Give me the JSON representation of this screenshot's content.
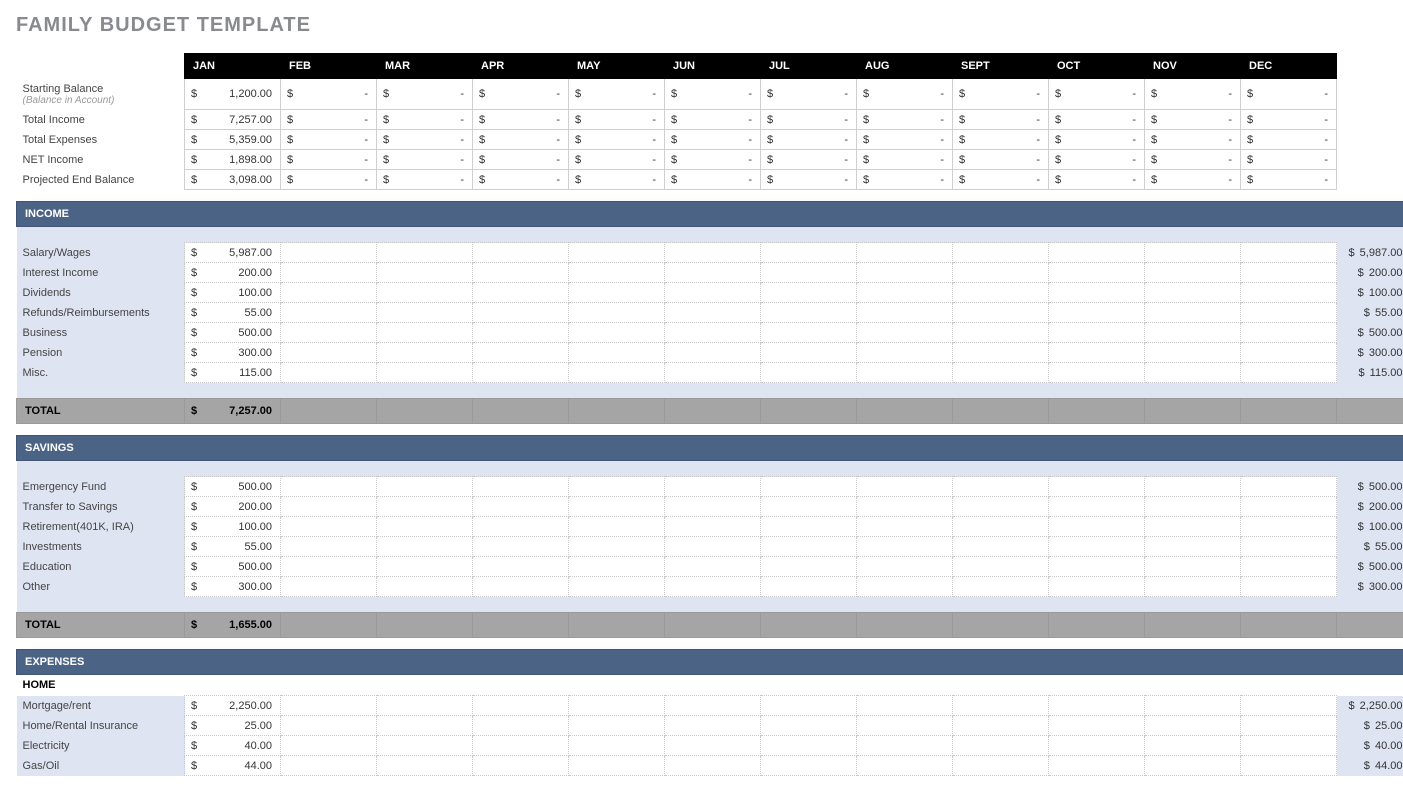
{
  "title": "FAMILY BUDGET TEMPLATE",
  "months": [
    "JAN",
    "FEB",
    "MAR",
    "APR",
    "MAY",
    "JUN",
    "JUL",
    "AUG",
    "SEPT",
    "OCT",
    "NOV",
    "DEC"
  ],
  "summary": [
    {
      "label": "Starting Balance",
      "sub": "(Balance in Account)",
      "jan": "1,200.00"
    },
    {
      "label": "Total Income",
      "jan": "7,257.00"
    },
    {
      "label": "Total Expenses",
      "jan": "5,359.00"
    },
    {
      "label": "NET Income",
      "jan": "1,898.00"
    },
    {
      "label": "Projected End Balance",
      "jan": "3,098.00"
    }
  ],
  "sections": [
    {
      "key": "income",
      "banner": "INCOME",
      "total_label": "TOTAL",
      "total_jan": "7,257.00",
      "rows": [
        {
          "label": "Salary/Wages",
          "jan": "5,987.00",
          "rowtotal": "5,987.00"
        },
        {
          "label": "Interest Income",
          "jan": "200.00",
          "rowtotal": "200.00"
        },
        {
          "label": "Dividends",
          "jan": "100.00",
          "rowtotal": "100.00"
        },
        {
          "label": "Refunds/Reimbursements",
          "jan": "55.00",
          "rowtotal": "55.00"
        },
        {
          "label": "Business",
          "jan": "500.00",
          "rowtotal": "500.00"
        },
        {
          "label": "Pension",
          "jan": "300.00",
          "rowtotal": "300.00"
        },
        {
          "label": "Misc.",
          "jan": "115.00",
          "rowtotal": "115.00"
        }
      ]
    },
    {
      "key": "savings",
      "banner": "SAVINGS",
      "total_label": "TOTAL",
      "total_jan": "1,655.00",
      "rows": [
        {
          "label": "Emergency Fund",
          "jan": "500.00",
          "rowtotal": "500.00"
        },
        {
          "label": "Transfer to Savings",
          "jan": "200.00",
          "rowtotal": "200.00"
        },
        {
          "label": "Retirement(401K, IRA)",
          "jan": "100.00",
          "rowtotal": "100.00"
        },
        {
          "label": "Investments",
          "jan": "55.00",
          "rowtotal": "55.00"
        },
        {
          "label": "Education",
          "jan": "500.00",
          "rowtotal": "500.00"
        },
        {
          "label": "Other",
          "jan": "300.00",
          "rowtotal": "300.00"
        }
      ]
    },
    {
      "key": "expenses",
      "banner": "EXPENSES",
      "subsections": [
        {
          "label": "HOME",
          "rows": [
            {
              "label": "Mortgage/rent",
              "jan": "2,250.00",
              "rowtotal": "2,250.00"
            },
            {
              "label": "Home/Rental Insurance",
              "jan": "25.00",
              "rowtotal": "25.00"
            },
            {
              "label": "Electricity",
              "jan": "40.00",
              "rowtotal": "40.00"
            },
            {
              "label": "Gas/Oil",
              "jan": "44.00",
              "rowtotal": "44.00"
            }
          ]
        }
      ]
    }
  ],
  "currency": "$",
  "dash": "-"
}
